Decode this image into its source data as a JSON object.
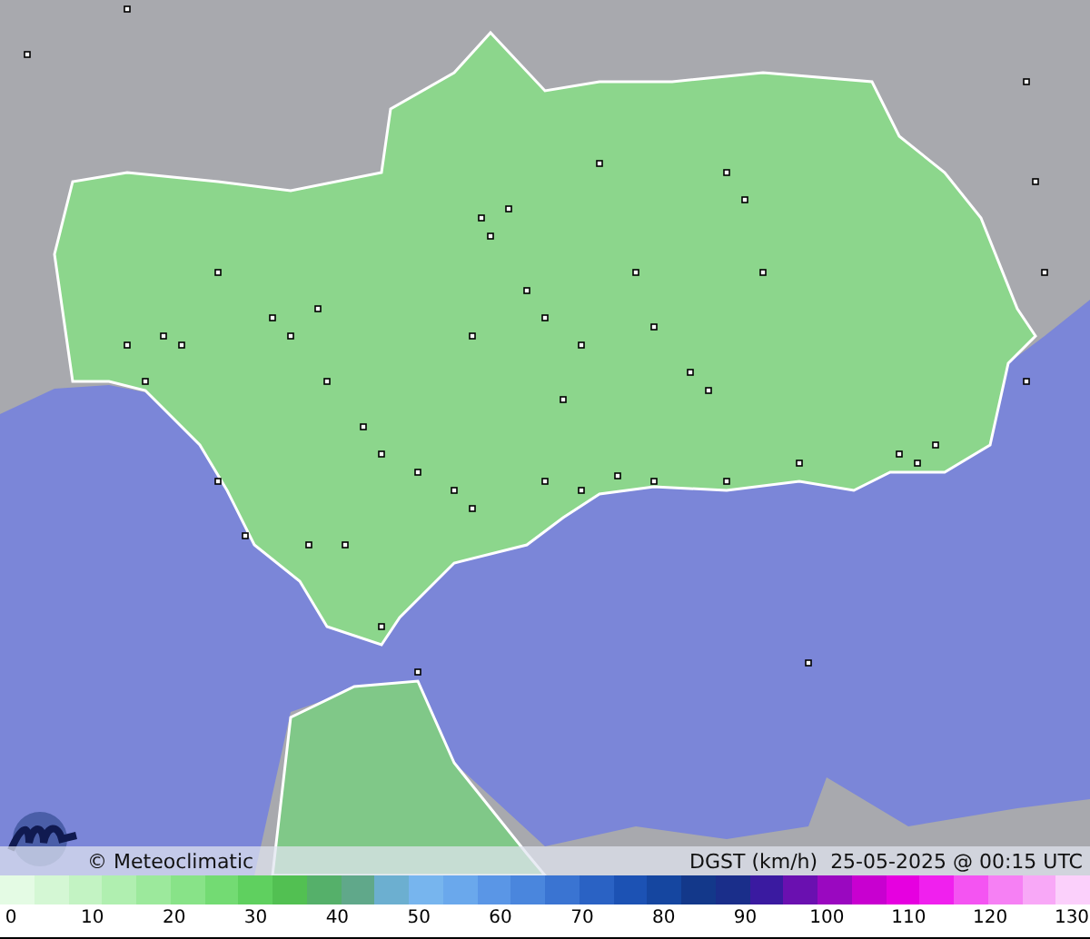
{
  "caption": {
    "copyright": "© Meteoclimatic",
    "info": "DGST (km/h)  25-05-2025 @ 00:15 UTC"
  },
  "legend": {
    "ticks": [
      "0",
      "10",
      "20",
      "30",
      "40",
      "50",
      "60",
      "70",
      "80",
      "90",
      "100",
      "110",
      "120",
      "130"
    ]
  }
}
